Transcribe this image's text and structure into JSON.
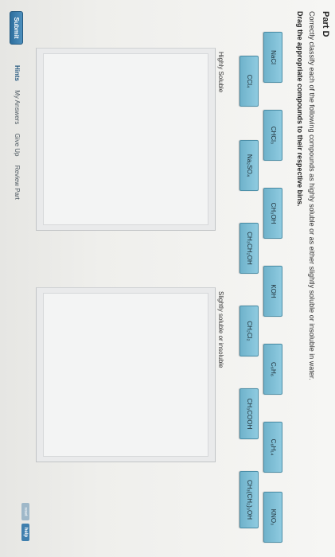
{
  "header": {
    "part_title": "Part D",
    "instructions": "Correctly classify each of the following compounds as highly soluble or as either slightly soluble or insoluble in water.",
    "drag_instruction": "Drag the appropriate compounds to their respective bins."
  },
  "compounds": {
    "row1": [
      "NaCl",
      "CHCl₃",
      "CH₃OH",
      "KOH",
      "C₆H₆",
      "C₆H₁₄",
      "KNO₃"
    ],
    "row2": [
      "CCl₄",
      "Na₂SO₄",
      "CH₃CH₂OH",
      "CH₂Cl₂",
      "CH₃COOH",
      "CH₃(CH₂)₃OH"
    ]
  },
  "bins": {
    "soluble_label": "Highly Soluble",
    "insoluble_label": "Slightly soluble or insoluble"
  },
  "buttons": {
    "reset": "reset",
    "help": "help",
    "submit": "Submit"
  },
  "footer": {
    "hints": "Hints",
    "my_answers": "My Answers",
    "give_up": "Give Up",
    "review_part": "Review Part"
  },
  "colors": {
    "chip_fill": "#7fbfd6",
    "chip_border": "#4b8ea7",
    "submit": "#3a7fae"
  }
}
